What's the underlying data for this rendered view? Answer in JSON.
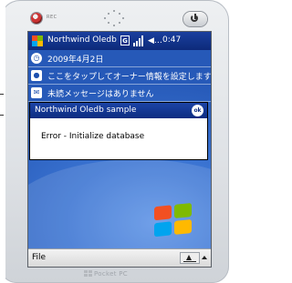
{
  "device": {
    "rec_label": "REC",
    "brand": "Pocket PC"
  },
  "titlebar": {
    "title": "Northwind Oledb",
    "badge": "G",
    "time": "0:47"
  },
  "today": {
    "date": "2009年4月2日",
    "owner_prompt": "ここをタップしてオーナー情報を設定します",
    "messages": "未読メッセージはありません"
  },
  "dialog": {
    "title": "Northwind Oledb sample",
    "ok_label": "ok",
    "message": "Error - Initialize database"
  },
  "menubar": {
    "file": "File"
  },
  "colors": {
    "titlebar": "#0d2a7a",
    "wallpaper": "#2d67c4",
    "dialog_bg": "#ffffff"
  }
}
